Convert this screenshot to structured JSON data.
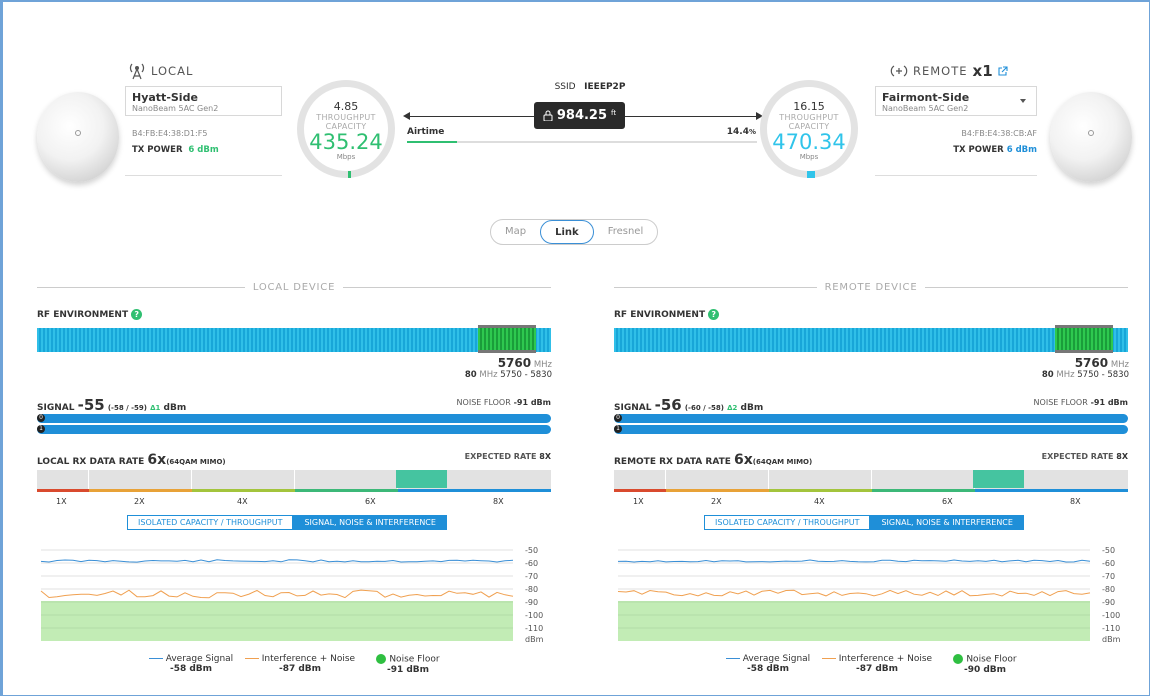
{
  "local": {
    "header": "LOCAL",
    "device_name": "Hyatt-Side",
    "device_model": "NanoBeam 5AC Gen2",
    "mac": "B4:FB:E4:38:D1:F5",
    "tx_power_label": "TX POWER",
    "tx_power_value": "6 dBm",
    "gauge": {
      "top": "4.85",
      "line1": "THROUGHPUT",
      "line2": "CAPACITY",
      "value": "435.24",
      "unit": "Mbps",
      "color": "#2fbf71"
    }
  },
  "remote": {
    "header": "REMOTE",
    "header_suffix": "x1",
    "device_name": "Fairmont-Side",
    "device_model": "NanoBeam 5AC Gen2",
    "mac": "B4:FB:E4:38:CB:AF",
    "tx_power_label": "TX POWER",
    "tx_power_value": "6 dBm",
    "gauge": {
      "top": "16.15",
      "line1": "THROUGHPUT",
      "line2": "CAPACITY",
      "value": "470.34",
      "unit": "Mbps",
      "color": "#30c4ea"
    }
  },
  "link": {
    "ssid_label": "SSID",
    "ssid_value": "IEEEP2P",
    "distance_value": "984.25",
    "distance_unit": "ft",
    "airtime_label": "Airtime",
    "airtime_value": "14.4",
    "airtime_unit": "%",
    "airtime_fraction": 0.144
  },
  "view_tabs": [
    "Map",
    "Link",
    "Fresnel"
  ],
  "view_tabs_active": "Link",
  "panels": [
    {
      "section_title": "LOCAL DEVICE",
      "rf_label": "RF ENVIRONMENT",
      "freq_mhz": "5760",
      "freq_unit": "MHz",
      "width_mhz": "80",
      "range": "5750 - 5830",
      "signal_label": "SIGNAL",
      "signal_value": "-55",
      "signal_chains": "(-58 / -59)",
      "signal_delta": "Δ1",
      "signal_unit": "dBm",
      "noise_floor_label": "NOISE FLOOR",
      "noise_floor_value": "-91 dBm",
      "rate_label": "LOCAL RX DATA RATE",
      "rate_value": "6x",
      "rate_mod": "(64QAM MIMO)",
      "expected_label": "EXPECTED RATE",
      "expected_value": "8X",
      "rate_ticks": [
        "1X",
        "2X",
        "4X",
        "6X",
        "8X"
      ],
      "tab_off": "ISOLATED CAPACITY / THROUGHPUT",
      "tab_on": "SIGNAL, NOISE & INTERFERENCE",
      "y_ticks": [
        "-50",
        "-60",
        "-70",
        "-80",
        "-90",
        "-100",
        "-110",
        "dBm"
      ],
      "legend": [
        {
          "name": "Average Signal",
          "value": "-58 dBm",
          "color": "#3a8fd6"
        },
        {
          "name": "Interference + Noise",
          "value": "-87 dBm",
          "color": "#f0a050"
        },
        {
          "name": "Noise Floor",
          "value": "-91 dBm",
          "color": "#2fbf41"
        }
      ]
    },
    {
      "section_title": "REMOTE DEVICE",
      "rf_label": "RF ENVIRONMENT",
      "freq_mhz": "5760",
      "freq_unit": "MHz",
      "width_mhz": "80",
      "range": "5750 - 5830",
      "signal_label": "SIGNAL",
      "signal_value": "-56",
      "signal_chains": "(-60 / -58)",
      "signal_delta": "Δ2",
      "signal_unit": "dBm",
      "noise_floor_label": "NOISE FLOOR",
      "noise_floor_value": "-91 dBm",
      "rate_label": "REMOTE RX DATA RATE",
      "rate_value": "6x",
      "rate_mod": "(64QAM MIMO)",
      "expected_label": "EXPECTED RATE",
      "expected_value": "8X",
      "rate_ticks": [
        "1X",
        "2X",
        "4X",
        "6X",
        "8X"
      ],
      "tab_off": "ISOLATED CAPACITY / THROUGHPUT",
      "tab_on": "SIGNAL, NOISE & INTERFERENCE",
      "y_ticks": [
        "-50",
        "-60",
        "-70",
        "-80",
        "-90",
        "-100",
        "-110",
        "dBm"
      ],
      "legend": [
        {
          "name": "Average Signal",
          "value": "-58 dBm",
          "color": "#3a8fd6"
        },
        {
          "name": "Interference + Noise",
          "value": "-87 dBm",
          "color": "#f0a050"
        },
        {
          "name": "Noise Floor",
          "value": "-90 dBm",
          "color": "#2fbf41"
        }
      ]
    }
  ]
}
